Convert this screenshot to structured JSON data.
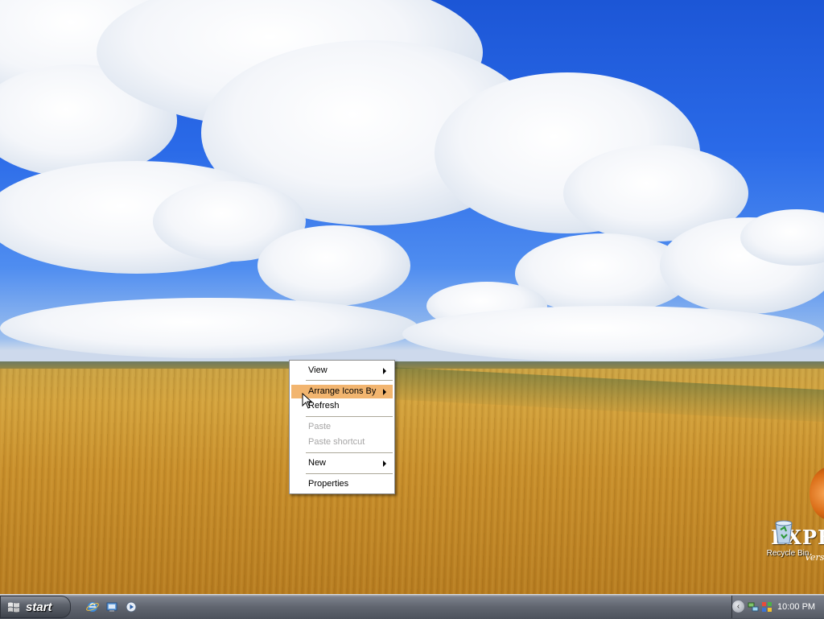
{
  "context_menu": {
    "items": [
      {
        "label": "View",
        "submenu": true,
        "enabled": true
      },
      {
        "label": "Arrange Icons By",
        "submenu": true,
        "enabled": true,
        "highlighted": true
      },
      {
        "label": "Refresh",
        "submenu": false,
        "enabled": true
      },
      {
        "label": "Paste",
        "submenu": false,
        "enabled": false
      },
      {
        "label": "Paste shortcut",
        "submenu": false,
        "enabled": false
      },
      {
        "label": "New",
        "submenu": true,
        "enabled": true
      },
      {
        "label": "Properties",
        "submenu": false,
        "enabled": true
      }
    ],
    "highlight_color": "#f2b56f"
  },
  "desktop": {
    "icons": [
      {
        "label": "Recycle Bin",
        "icon": "recycle-bin-icon"
      }
    ],
    "brand": {
      "text": "EXPE",
      "sub": "Vers"
    }
  },
  "taskbar": {
    "start_label": "start",
    "quick_launch": [
      "internet-explorer-icon",
      "show-desktop-icon",
      "media-player-icon"
    ],
    "tray_icons": [
      "show-hidden-icons-chevron",
      "network-icon",
      "security-icon"
    ],
    "clock": "10:00 PM"
  }
}
